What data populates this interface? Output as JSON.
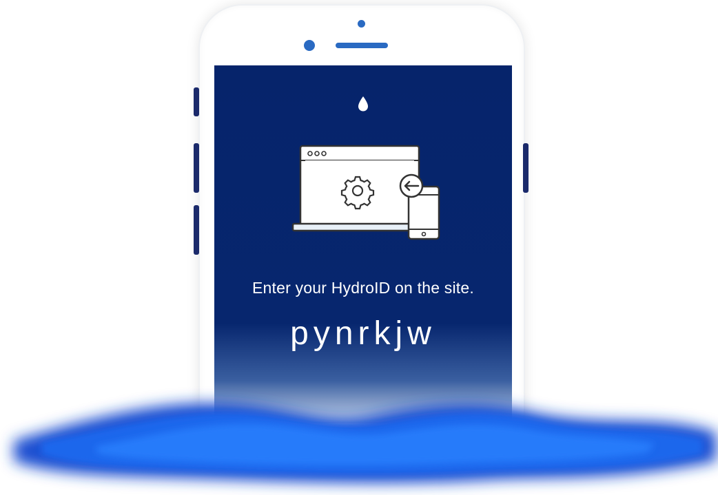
{
  "app": {
    "instruction": "Enter your HydroID on the site.",
    "hydro_id": "pynrkjw"
  },
  "colors": {
    "screen_background": "#06246b",
    "accent": "#2a6ac2",
    "water": "#1a5fe0",
    "text": "#ffffff"
  },
  "icons": [
    "water-drop-icon",
    "laptop-settings-icon",
    "gear-icon",
    "smartphone-icon",
    "arrow-left-icon"
  ]
}
